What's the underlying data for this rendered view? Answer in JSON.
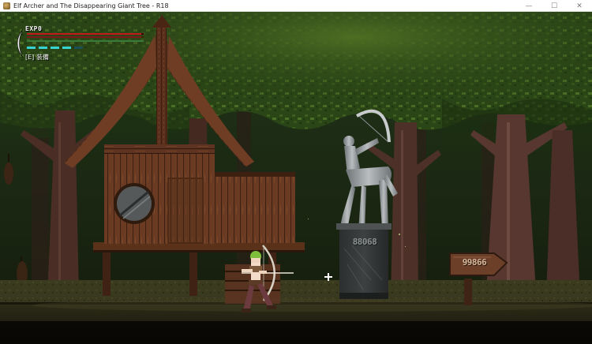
{
  "window": {
    "title": "Elf Archer and The Disappearing Giant Tree - R18",
    "minimize_glyph": "—",
    "maximize_glyph": "☐",
    "close_glyph": "✕"
  },
  "hud": {
    "exp_label": "EXP0",
    "equip_label": "[E] 装備",
    "hp_fraction": 0.98,
    "sp_fraction": 0.98,
    "pips_total": 5,
    "pips_filled": 4,
    "hp_color": "#c21a1a",
    "pip_color": "#37d3d3"
  },
  "world": {
    "statue_plinth_text": "88068",
    "signpost_text": "99866"
  },
  "colors": {
    "forest_canopy": "#2f4a17",
    "tree_trunk": "#4b2f26",
    "ground": "#2b2a18",
    "hut_wood": "#6b3c22"
  },
  "icons": {
    "app": "game-app-icon",
    "cursor": "crosshair-icon",
    "moon": "crescent-moon-icon"
  }
}
